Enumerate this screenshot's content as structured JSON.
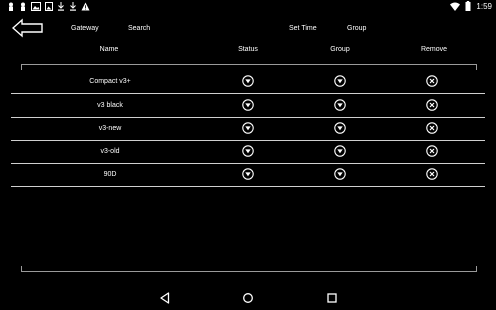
{
  "status_bar": {
    "left_icons": [
      "person-pin-icon",
      "person-pin-icon",
      "image-icon",
      "photo-icon",
      "download-icon",
      "download-icon",
      "warning-icon"
    ],
    "right_icons": [
      "wifi-icon",
      "battery-icon"
    ],
    "time": "1:59"
  },
  "toolbar": {
    "gateway_label": "Gateway",
    "search_label": "Search",
    "set_time_label": "Set Time",
    "group_label": "Group"
  },
  "table": {
    "columns": [
      "Name",
      "Status",
      "Group",
      "Remove"
    ],
    "rows": [
      {
        "name": "Compact v3+"
      },
      {
        "name": "v3 black"
      },
      {
        "name": "v3-new"
      },
      {
        "name": "v3-old"
      },
      {
        "name": "90D"
      }
    ]
  },
  "nav": {
    "buttons": [
      "back-triangle-icon",
      "home-circle-icon",
      "recents-square-icon"
    ]
  }
}
